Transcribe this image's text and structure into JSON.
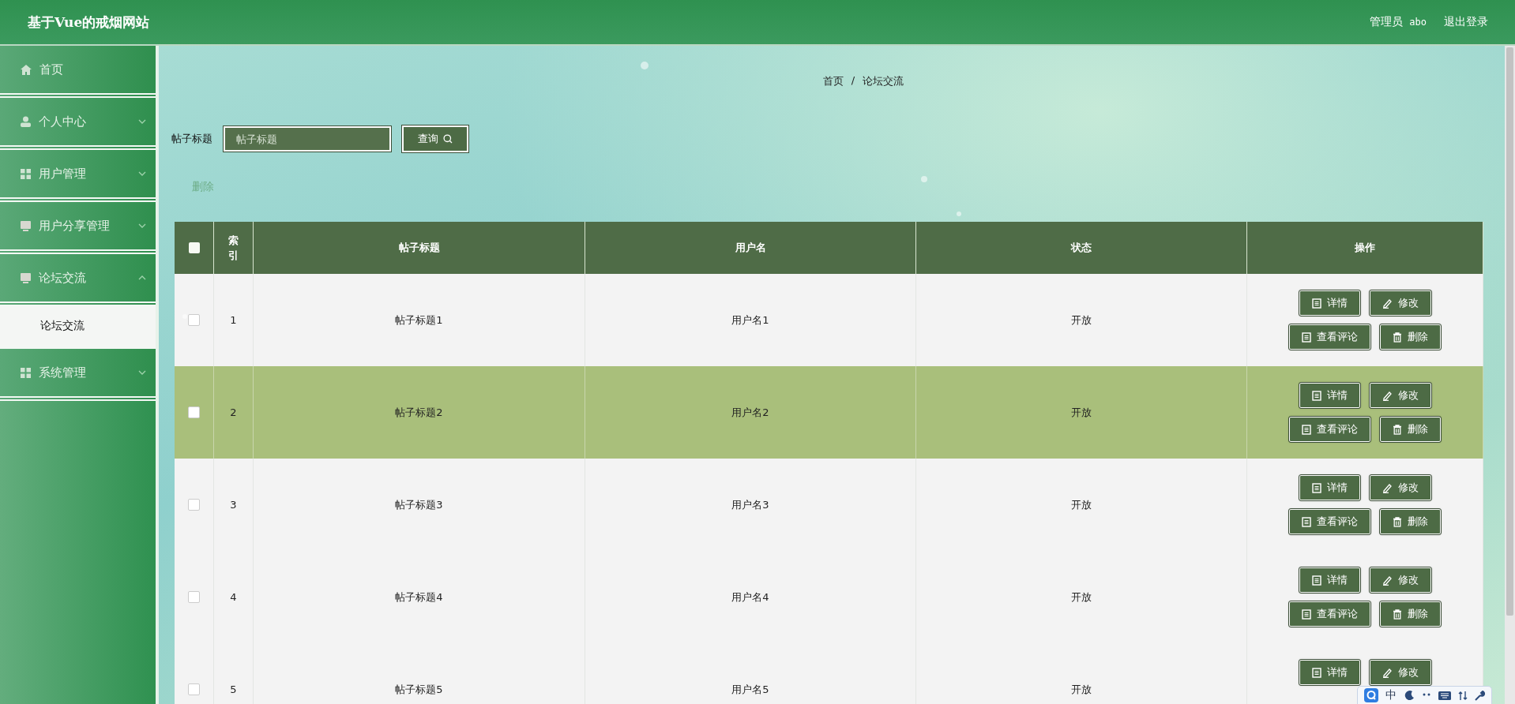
{
  "header": {
    "title": "基于Vue的戒烟网站",
    "user_role": "管理员",
    "username": "abo",
    "logout": "退出登录"
  },
  "sidebar": {
    "items": [
      {
        "label": "首页",
        "kind": "link"
      },
      {
        "label": "个人中心",
        "kind": "group",
        "expanded": false
      },
      {
        "label": "用户管理",
        "kind": "group",
        "expanded": false
      },
      {
        "label": "用户分享管理",
        "kind": "group",
        "expanded": false
      },
      {
        "label": "论坛交流",
        "kind": "group",
        "expanded": true,
        "children": [
          {
            "label": "论坛交流",
            "selected": true
          }
        ]
      },
      {
        "label": "系统管理",
        "kind": "group",
        "expanded": false
      }
    ]
  },
  "breadcrumb": {
    "items": [
      "首页",
      "论坛交流"
    ],
    "separator": "/"
  },
  "search": {
    "label": "帖子标题",
    "placeholder": "帖子标题",
    "button": "查询"
  },
  "bulk_delete": {
    "label": "删除",
    "disabled": true
  },
  "table": {
    "select_all_checked": false,
    "columns": [
      "索引",
      "帖子标题",
      "用户名",
      "状态",
      "操作"
    ],
    "rows": [
      {
        "index": "1",
        "title": "帖子标题1",
        "username": "用户名1",
        "status": "开放",
        "checked": false,
        "highlighted": false,
        "actions": [
          {
            "label": "详情",
            "kind": "details"
          },
          {
            "label": "修改",
            "kind": "edit"
          },
          {
            "label": "查看评论",
            "kind": "comments"
          },
          {
            "label": "删除",
            "kind": "delete"
          }
        ]
      },
      {
        "index": "2",
        "title": "帖子标题2",
        "username": "用户名2",
        "status": "开放",
        "checked": false,
        "highlighted": true,
        "actions": [
          {
            "label": "详情",
            "kind": "details"
          },
          {
            "label": "修改",
            "kind": "edit"
          },
          {
            "label": "查看评论",
            "kind": "comments"
          },
          {
            "label": "删除",
            "kind": "delete"
          }
        ]
      },
      {
        "index": "3",
        "title": "帖子标题3",
        "username": "用户名3",
        "status": "开放",
        "checked": false,
        "highlighted": false,
        "actions": [
          {
            "label": "详情",
            "kind": "details"
          },
          {
            "label": "修改",
            "kind": "edit"
          },
          {
            "label": "查看评论",
            "kind": "comments"
          },
          {
            "label": "删除",
            "kind": "delete"
          }
        ]
      },
      {
        "index": "4",
        "title": "帖子标题4",
        "username": "用户名4",
        "status": "开放",
        "checked": false,
        "highlighted": false,
        "actions": [
          {
            "label": "详情",
            "kind": "details"
          },
          {
            "label": "修改",
            "kind": "edit"
          },
          {
            "label": "查看评论",
            "kind": "comments"
          },
          {
            "label": "删除",
            "kind": "delete"
          }
        ]
      },
      {
        "index": "5",
        "title": "帖子标题5",
        "username": "用户名5",
        "status": "开放",
        "checked": false,
        "highlighted": false,
        "actions": [
          {
            "label": "详情",
            "kind": "details"
          },
          {
            "label": "修改",
            "kind": "edit"
          }
        ]
      }
    ]
  },
  "ime_toolbar": {
    "mode": "中"
  }
}
